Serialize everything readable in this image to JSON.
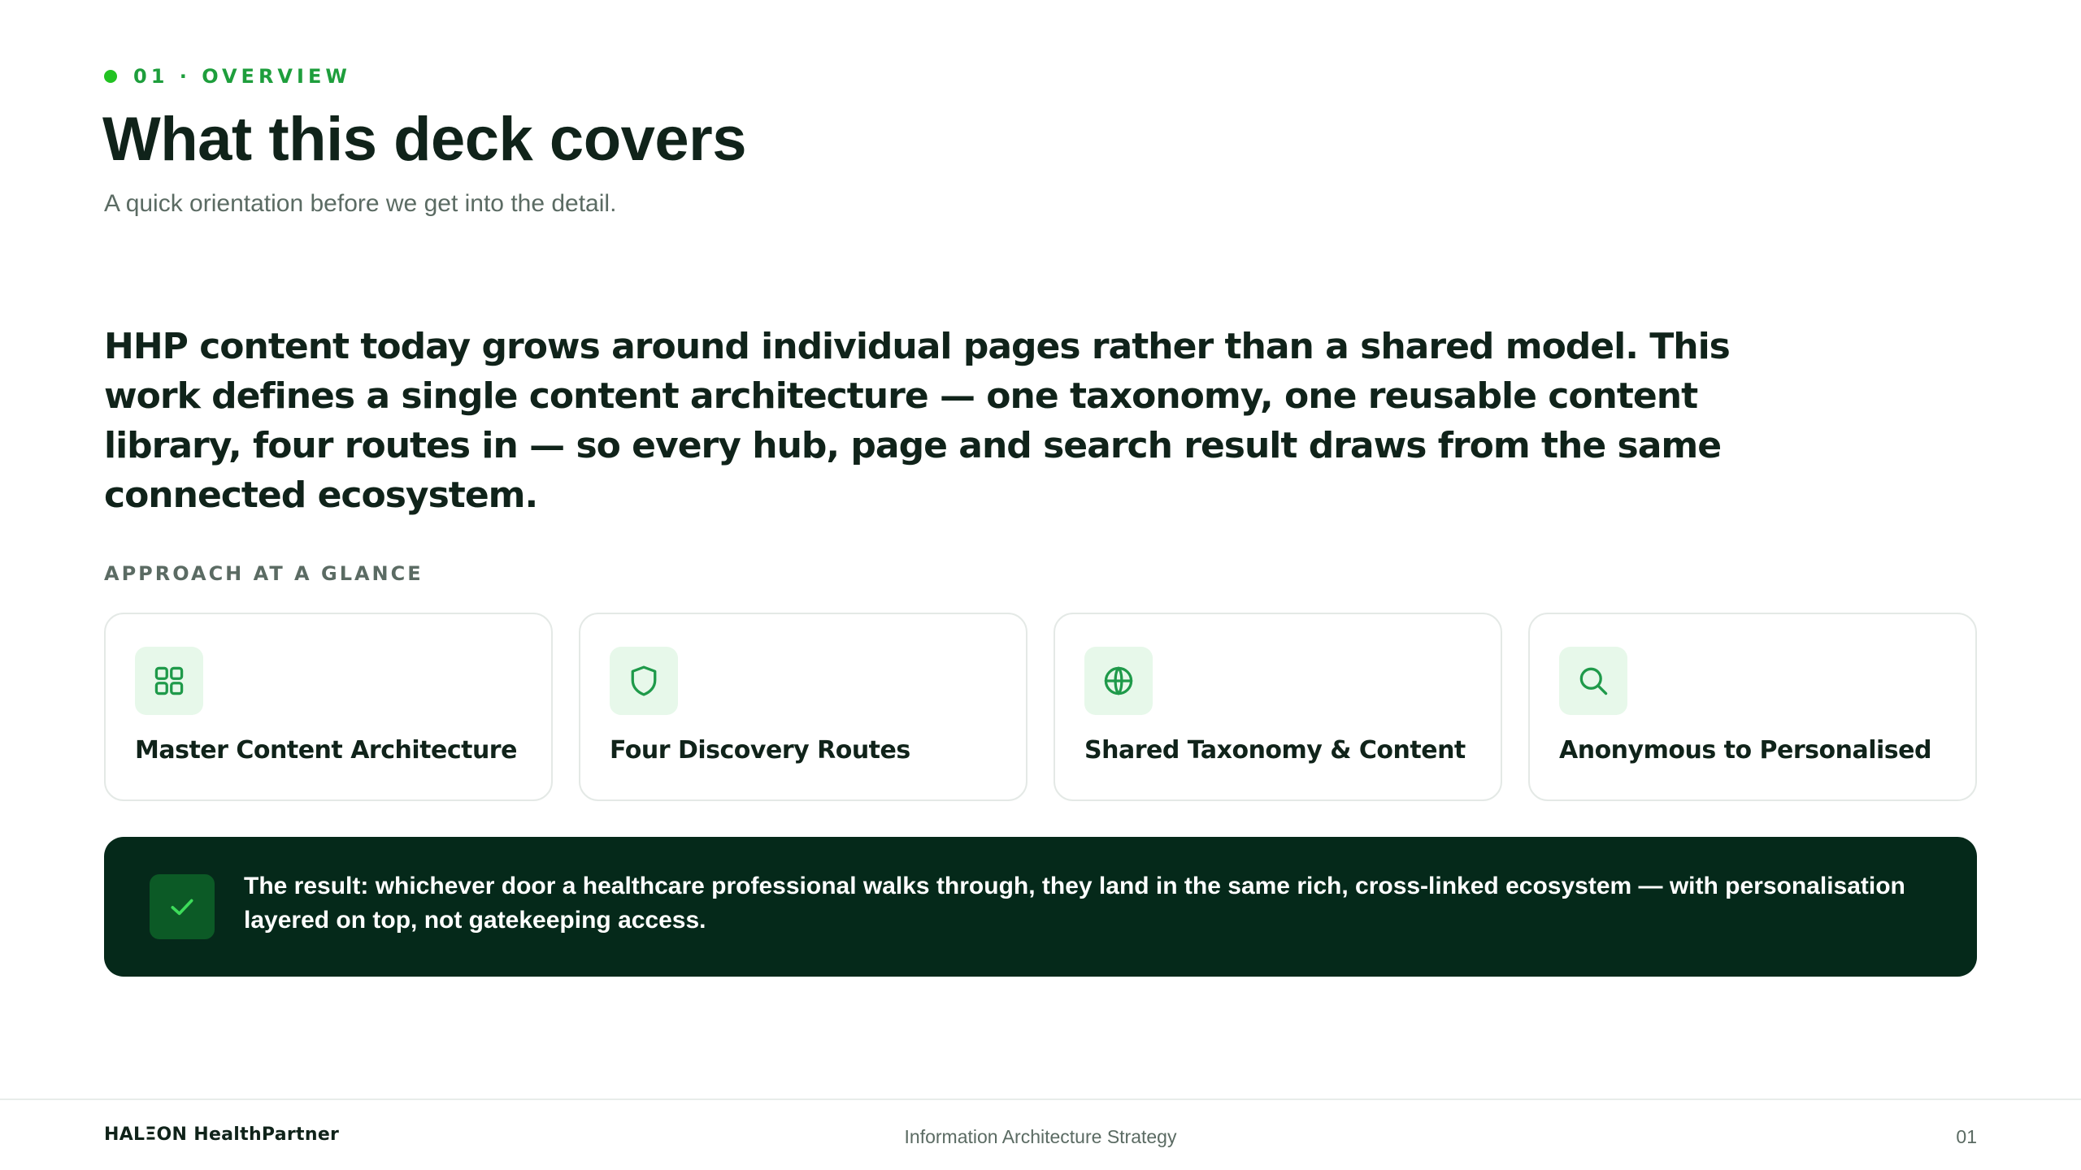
{
  "header": {
    "eyebrow": "01 · OVERVIEW",
    "title": "What this deck covers",
    "subtitle": "A quick orientation before we get into the detail."
  },
  "lead": "HHP content today grows around individual pages rather than a shared model. This work defines a single content architecture — one taxonomy, one reusable content library, four routes in — so every hub, page and search result draws from the same connected ecosystem.",
  "approach": {
    "label": "APPROACH AT A GLANCE",
    "cards": [
      {
        "label": "Master Content Architecture",
        "icon": "grid-icon"
      },
      {
        "label": "Four Discovery Routes",
        "icon": "shield-icon"
      },
      {
        "label": "Shared Taxonomy & Content",
        "icon": "globe-icon"
      },
      {
        "label": "Anonymous to Personalised",
        "icon": "search-icon"
      }
    ]
  },
  "result": {
    "icon": "check-icon",
    "text": "The result: whichever door a healthcare professional walks through, they land in the same rich, cross-linked ecosystem — with personalisation layered on top, not gatekeeping access."
  },
  "footer": {
    "brand": "HALΞON HealthPartner",
    "center": "Information Architecture Strategy",
    "page": "01"
  },
  "colors": {
    "accent": "#22c222",
    "accent_dark": "#1e9e3c",
    "icon_stroke": "#1f9a4a",
    "icon_bg": "#e7f8ea",
    "result_bg": "#05291a",
    "text_dark": "#10231a",
    "text_muted": "#5b6b63"
  }
}
